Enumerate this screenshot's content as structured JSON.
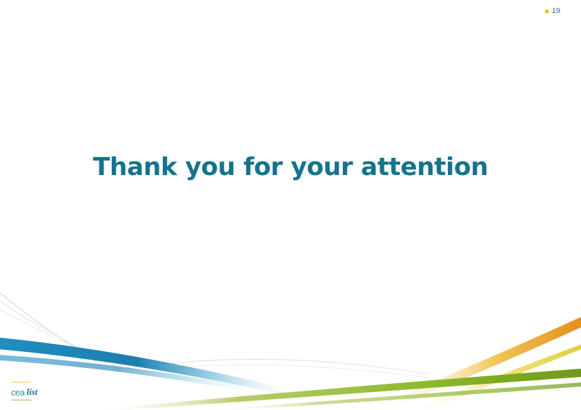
{
  "slide": {
    "page_number": "19",
    "title": "Thank you for your attention",
    "logo": {
      "brand": "cea",
      "product": "list"
    }
  },
  "colors": {
    "title": "#15748c",
    "page_marker": "#e8c21a",
    "swoosh_blue": "#1a7fb0",
    "swoosh_green": "#7fa51f",
    "swoosh_orange": "#e8961a"
  }
}
